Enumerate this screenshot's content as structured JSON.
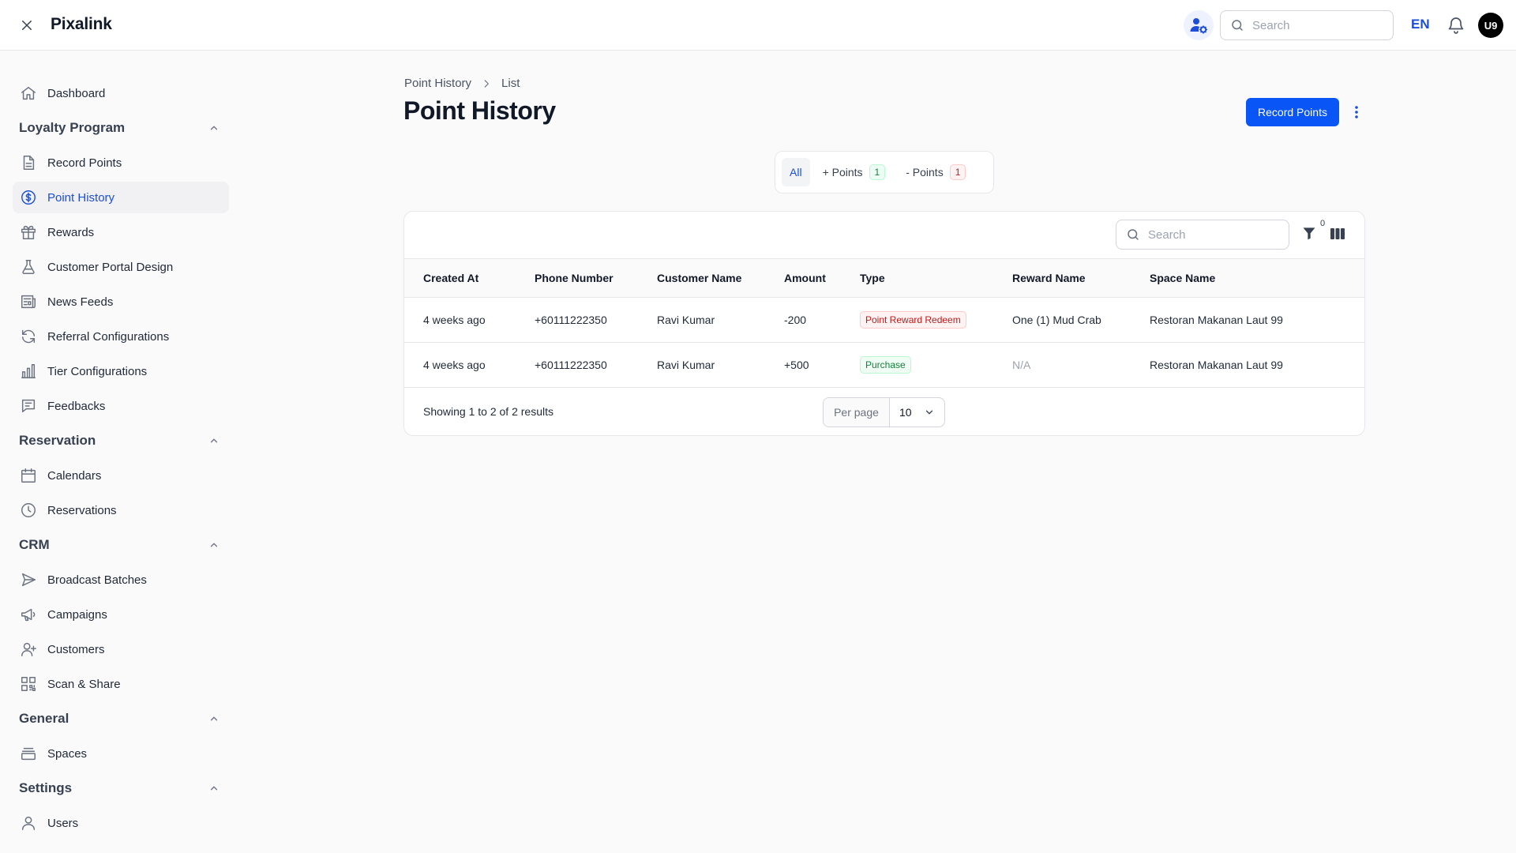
{
  "app": {
    "brand": "Pixalink",
    "search_placeholder": "Search",
    "language": "EN",
    "avatar_initials": "U9"
  },
  "sidebar": {
    "items": [
      {
        "type": "item",
        "label": "Dashboard",
        "icon": "home-icon"
      },
      {
        "type": "group",
        "label": "Loyalty Program"
      },
      {
        "type": "item",
        "label": "Record Points",
        "icon": "document-icon"
      },
      {
        "type": "item",
        "label": "Point History",
        "icon": "dollar-circle-icon",
        "active": true
      },
      {
        "type": "item",
        "label": "Rewards",
        "icon": "gift-icon"
      },
      {
        "type": "item",
        "label": "Customer Portal Design",
        "icon": "beaker-icon"
      },
      {
        "type": "item",
        "label": "News Feeds",
        "icon": "newspaper-icon"
      },
      {
        "type": "item",
        "label": "Referral Configurations",
        "icon": "refresh-icon"
      },
      {
        "type": "item",
        "label": "Tier Configurations",
        "icon": "bar-chart-icon"
      },
      {
        "type": "item",
        "label": "Feedbacks",
        "icon": "chat-icon"
      },
      {
        "type": "group",
        "label": "Reservation"
      },
      {
        "type": "item",
        "label": "Calendars",
        "icon": "calendar-icon"
      },
      {
        "type": "item",
        "label": "Reservations",
        "icon": "clock-icon"
      },
      {
        "type": "group",
        "label": "CRM"
      },
      {
        "type": "item",
        "label": "Broadcast Batches",
        "icon": "send-icon"
      },
      {
        "type": "item",
        "label": "Campaigns",
        "icon": "megaphone-icon"
      },
      {
        "type": "item",
        "label": "Customers",
        "icon": "user-plus-icon"
      },
      {
        "type": "item",
        "label": "Scan & Share",
        "icon": "qr-code-icon"
      },
      {
        "type": "group",
        "label": "General"
      },
      {
        "type": "item",
        "label": "Spaces",
        "icon": "stack-icon"
      },
      {
        "type": "group",
        "label": "Settings"
      },
      {
        "type": "item",
        "label": "Users",
        "icon": "user-icon"
      }
    ]
  },
  "breadcrumb": {
    "items": [
      "Point History",
      "List"
    ]
  },
  "page": {
    "title": "Point History",
    "primary_action": "Record Points"
  },
  "tabs": [
    {
      "label": "All",
      "active": true
    },
    {
      "label": "+ Points",
      "count": "1",
      "color": "green"
    },
    {
      "label": "- Points",
      "count": "1",
      "color": "red"
    }
  ],
  "table": {
    "search_placeholder": "Search",
    "filter_count": "0",
    "columns": [
      "Created At",
      "Phone Number",
      "Customer Name",
      "Amount",
      "Type",
      "Reward Name",
      "Space Name"
    ],
    "rows": [
      {
        "created_at": "4 weeks ago",
        "phone": "+60111222350",
        "customer": "Ravi Kumar",
        "amount": "-200",
        "type": "Point Reward Redeem",
        "type_color": "red",
        "reward": "One (1) Mud Crab",
        "space": "Restoran Makanan Laut 99"
      },
      {
        "created_at": "4 weeks ago",
        "phone": "+60111222350",
        "customer": "Ravi Kumar",
        "amount": "+500",
        "type": "Purchase",
        "type_color": "green",
        "reward": "N/A",
        "space": "Restoran Makanan Laut 99"
      }
    ],
    "footer": {
      "showing": "Showing 1 to 2 of 2 results",
      "per_page_label": "Per page",
      "per_page_value": "10"
    }
  },
  "colors": {
    "accent": "#0a55f5",
    "active_text": "#1d4ed8"
  }
}
